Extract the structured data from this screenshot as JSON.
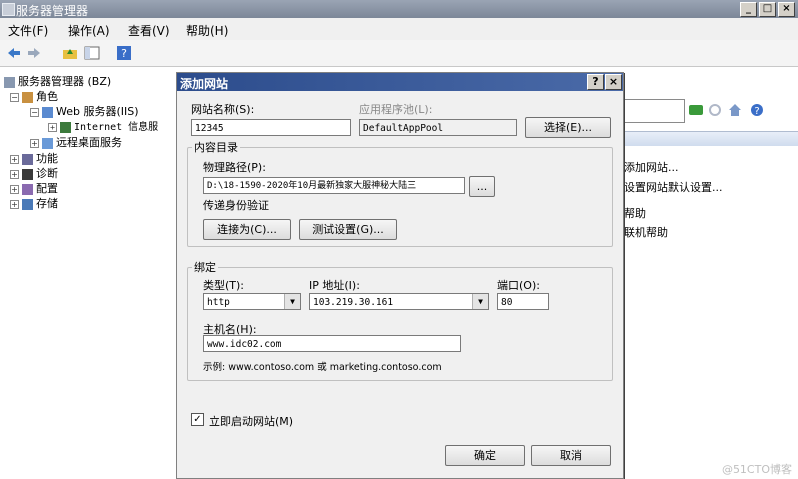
{
  "window": {
    "title": "服务器管理器",
    "controls": [
      "_",
      "□",
      "×"
    ]
  },
  "menubar": [
    "文件(F)",
    "操作(A)",
    "查看(V)",
    "帮助(H)"
  ],
  "tree": {
    "root": "服务器管理器 (BZ)",
    "roles": "角色",
    "web_server": "Web 服务器(IIS)",
    "iis_manager": "Internet 信息服",
    "remote_desktop": "远程桌面服务",
    "features": "功能",
    "diagnostics": "诊断",
    "configuration": "配置",
    "storage": "存储"
  },
  "actions": [
    "添加网站...",
    "设置网站默认设置...",
    "帮助",
    "联机帮助"
  ],
  "dialog": {
    "title": "添加网站",
    "help_btn": "?",
    "close_btn": "×",
    "site_name_label": "网站名称(S):",
    "site_name_value": "12345",
    "app_pool_label": "应用程序池(L):",
    "app_pool_value": "DefaultAppPool",
    "select_btn": "选择(E)...",
    "content_group": "内容目录",
    "physical_path_label": "物理路径(P):",
    "physical_path_value": "D:\\18-1590-2020年10月最新独家大服神秘大陆三",
    "browse_btn": "...",
    "passthrough_label": "传递身份验证",
    "connect_as_btn": "连接为(C)...",
    "test_settings_btn": "测试设置(G)...",
    "binding_group": "绑定",
    "type_label": "类型(T):",
    "type_value": "http",
    "ip_label": "IP 地址(I):",
    "ip_value": "103.219.30.161",
    "port_label": "端口(O):",
    "port_value": "80",
    "hostname_label": "主机名(H):",
    "hostname_value": "www.idc02.com",
    "example_text": "示例: www.contoso.com 或 marketing.contoso.com",
    "start_checkbox_label": "立即启动网站(M)",
    "start_checked": true,
    "ok_btn": "确定",
    "cancel_btn": "取消"
  },
  "watermark": "@51CTO博客",
  "colors": {
    "dialog_title": "#2c4c8c",
    "main_title": "#8a94a6"
  }
}
